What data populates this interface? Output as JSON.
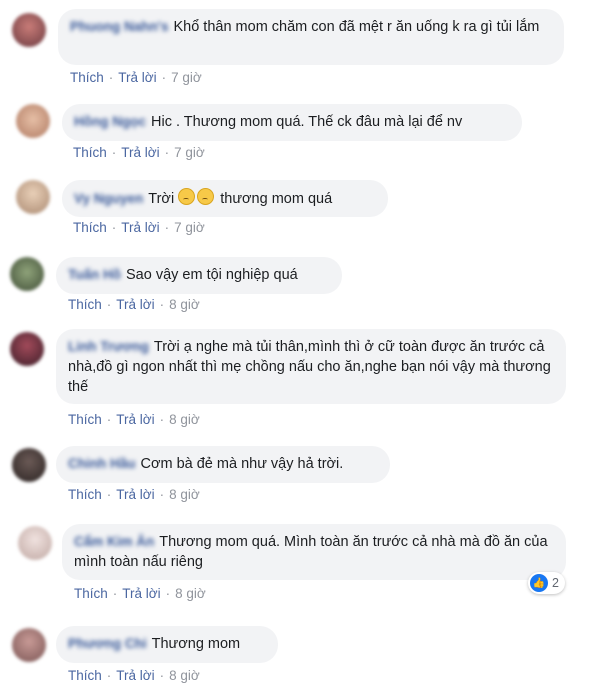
{
  "actions": {
    "like": "Thích",
    "reply": "Trả lời",
    "dot": "·"
  },
  "comments": [
    {
      "name": "Phuong Nahn's",
      "text": "Khổ thân mom chăm con đã mệt r ăn uống k ra gì tủi lắm",
      "time": "7 giờ"
    },
    {
      "name": "Hồng Ngọc",
      "text": "Hic . Thương mom quá. Thế ck đâu mà lại để nv",
      "time": "7 giờ"
    },
    {
      "name": "Vy Nguyen",
      "text_before": "Trời",
      "text_after": "thương mom quá",
      "emoji_icons": [
        "sad-face-icon",
        "sad-face-icon"
      ],
      "time": "7 giờ"
    },
    {
      "name": "Tuấn Hồ",
      "text": "Sao vậy em tội nghiệp quá",
      "time": "8 giờ"
    },
    {
      "name": "Linh Trương",
      "text": "Trời ạ nghe mà tủi thân,mình thì ở cữ toàn được ăn trước cả nhà,đồ gì ngon nhất thì mẹ chồng nấu cho ăn,nghe bạn nói vậy mà thương thế",
      "time": "8 giờ"
    },
    {
      "name": "Chinh Hầu",
      "text": "Cơm bà đẻ mà như vậy hả trời.",
      "time": "8 giờ"
    },
    {
      "name": "Cẩm Kim Ân",
      "text": "Thương mom quá. Mình toàn ăn trước cả nhà mà đồ ăn của mình toàn nấu riêng",
      "time": "8 giờ",
      "reactions": "2"
    },
    {
      "name": "Phương Chi",
      "text": "Thương mom",
      "time": "8 giờ"
    }
  ],
  "colors": {
    "link": "#385898",
    "bubble": "#f2f3f5",
    "meta": "#90949c",
    "like": "#1877f2"
  }
}
